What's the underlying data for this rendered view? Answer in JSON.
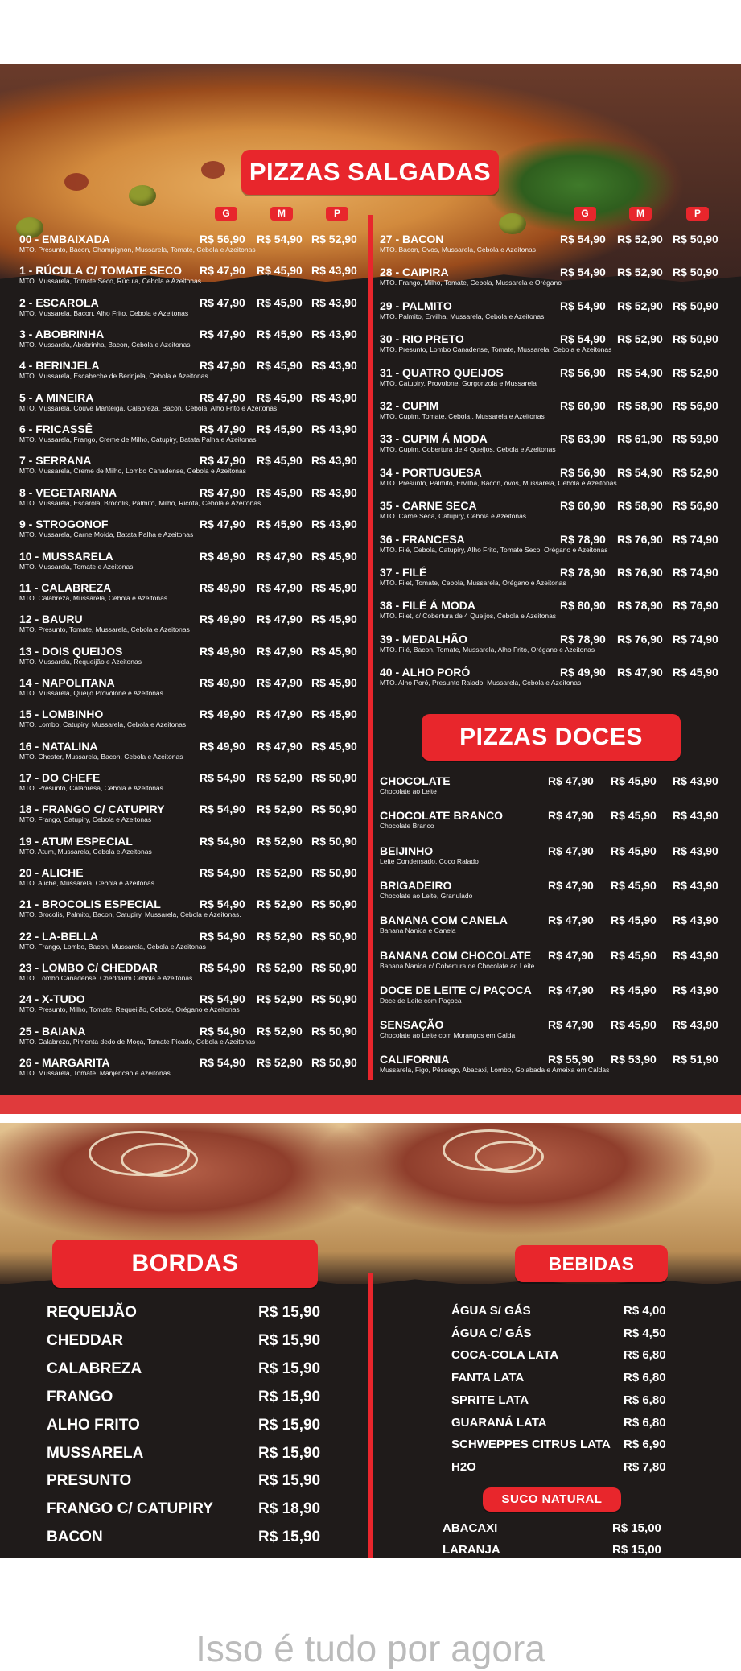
{
  "salgadas": {
    "title": "PIZZAS SALGADAS",
    "size_labels": [
      "G",
      "M",
      "P"
    ],
    "left": [
      {
        "name": "00 - EMBAIXADA",
        "desc": "MTO. Presunto, Bacon, Champignon, Mussarela, Tomate, Cebola e Azeitonas",
        "prices": [
          "R$ 56,90",
          "R$ 54,90",
          "R$ 52,90"
        ]
      },
      {
        "name": "1 - RÚCULA C/ TOMATE SECO",
        "desc": "MTO. Mussarela, Tomate Seco, Rúcula, Cebola e Azeitonas",
        "prices": [
          "R$ 47,90",
          "R$ 45,90",
          "R$ 43,90"
        ]
      },
      {
        "name": "2 - ESCAROLA",
        "desc": "MTO. Mussarela, Bacon, Alho Frito, Cebola e Azeitonas",
        "prices": [
          "R$ 47,90",
          "R$ 45,90",
          "R$ 43,90"
        ]
      },
      {
        "name": "3 - ABOBRINHA",
        "desc": "MTO. Mussarela, Abobrinha, Bacon, Cebola e Azeitonas",
        "prices": [
          "R$ 47,90",
          "R$ 45,90",
          "R$ 43,90"
        ]
      },
      {
        "name": "4 - BERINJELA",
        "desc": "MTO. Mussarela, Escabeche de Berinjela, Cebola e Azeitonas",
        "prices": [
          "R$ 47,90",
          "R$ 45,90",
          "R$ 43,90"
        ]
      },
      {
        "name": "5 - A MINEIRA",
        "desc": "MTO. Mussarela, Couve Manteiga, Calabreza, Bacon, Cebola, Alho Frito e Azeitonas",
        "prices": [
          "R$ 47,90",
          "R$ 45,90",
          "R$ 43,90"
        ]
      },
      {
        "name": "6 - FRICASSÊ",
        "desc": "MTO. Mussarela, Frango, Creme de Milho, Catupiry, Batata Palha e Azeitonas",
        "prices": [
          "R$ 47,90",
          "R$ 45,90",
          "R$ 43,90"
        ]
      },
      {
        "name": "7 - SERRANA",
        "desc": "MTO. Mussarela, Creme de Milho, Lombo Canadense, Cebola e Azeitonas",
        "prices": [
          "R$ 47,90",
          "R$ 45,90",
          "R$ 43,90"
        ]
      },
      {
        "name": "8 - VEGETARIANA",
        "desc": "MTO. Mussarela, Escarola, Brócolis, Palmito, Milho, Ricota, Cebola e Azeitonas",
        "prices": [
          "R$ 47,90",
          "R$ 45,90",
          "R$ 43,90"
        ]
      },
      {
        "name": "9 - STROGONOF",
        "desc": "MTO. Mussarela, Carne Moída, Batata Palha e Azeitonas",
        "prices": [
          "R$ 47,90",
          "R$ 45,90",
          "R$ 43,90"
        ]
      },
      {
        "name": "10 - MUSSARELA",
        "desc": "MTO. Mussarela, Tomate e Azeitonas",
        "prices": [
          "R$ 49,90",
          "R$ 47,90",
          "R$ 45,90"
        ]
      },
      {
        "name": "11 - CALABREZA",
        "desc": "MTO. Calabreza, Mussarela, Cebola e Azeitonas",
        "prices": [
          "R$ 49,90",
          "R$ 47,90",
          "R$ 45,90"
        ]
      },
      {
        "name": "12 - BAURU",
        "desc": "MTO. Presunto, Tomate, Mussarela, Cebola e Azeitonas",
        "prices": [
          "R$ 49,90",
          "R$ 47,90",
          "R$ 45,90"
        ]
      },
      {
        "name": "13 - DOIS QUEIJOS",
        "desc": "MTO. Mussarela, Requeijão e Azeitonas",
        "prices": [
          "R$ 49,90",
          "R$ 47,90",
          "R$ 45,90"
        ]
      },
      {
        "name": "14 - NAPOLITANA",
        "desc": "MTO. Mussarela, Queijo Provolone e Azeitonas",
        "prices": [
          "R$ 49,90",
          "R$ 47,90",
          "R$ 45,90"
        ]
      },
      {
        "name": "15 - LOMBINHO",
        "desc": "MTO. Lombo, Catupiry, Mussarela, Cebola e Azeitonas",
        "prices": [
          "R$ 49,90",
          "R$ 47,90",
          "R$ 45,90"
        ]
      },
      {
        "name": "16 - NATALINA",
        "desc": "MTO. Chester, Mussarela, Bacon, Cebola e Azeitonas",
        "prices": [
          "R$ 49,90",
          "R$ 47,90",
          "R$ 45,90"
        ]
      },
      {
        "name": "17 - DO CHEFE",
        "desc": "MTO. Presunto, Calabresa, Cebola e Azeitonas",
        "prices": [
          "R$ 54,90",
          "R$ 52,90",
          "R$ 50,90"
        ]
      },
      {
        "name": "18 - FRANGO C/ CATUPIRY",
        "desc": "MTO. Frango, Catupiry, Cebola e Azeitonas",
        "prices": [
          "R$ 54,90",
          "R$ 52,90",
          "R$ 50,90"
        ]
      },
      {
        "name": "19 - ATUM ESPECIAL",
        "desc": "MTO. Atum, Mussarela, Cebola e Azeitonas",
        "prices": [
          "R$ 54,90",
          "R$ 52,90",
          "R$ 50,90"
        ]
      },
      {
        "name": "20 - ALICHE",
        "desc": "MTO. Aliche, Mussarela, Cebola e Azeitonas",
        "prices": [
          "R$ 54,90",
          "R$ 52,90",
          "R$ 50,90"
        ]
      },
      {
        "name": "21 - BROCOLIS ESPECIAL",
        "desc": "MTO. Brocolis, Palmito, Bacon, Catupiry, Mussarela, Cebola e Azeitonas.",
        "prices": [
          "R$ 54,90",
          "R$ 52,90",
          "R$ 50,90"
        ]
      },
      {
        "name": "22 - LA-BELLA",
        "desc": "MTO. Frango, Lombo, Bacon, Mussarela, Cebola e Azeitonas",
        "prices": [
          "R$ 54,90",
          "R$ 52,90",
          "R$ 50,90"
        ]
      },
      {
        "name": "23 - LOMBO C/ CHEDDAR",
        "desc": "MTO. Lombo Canadense, Cheddarm Cebola e Azeitonas",
        "prices": [
          "R$ 54,90",
          "R$ 52,90",
          "R$ 50,90"
        ]
      },
      {
        "name": "24 - X-TUDO",
        "desc": "MTO. Presunto, Milho, Tomate, Requeijão, Cebola, Orégano e Azeitonas",
        "prices": [
          "R$ 54,90",
          "R$ 52,90",
          "R$ 50,90"
        ]
      },
      {
        "name": "25 - BAIANA",
        "desc": "MTO. Calabreza, Pimenta dedo de Moça, Tomate Picado, Cebola e Azeitonas",
        "prices": [
          "R$ 54,90",
          "R$ 52,90",
          "R$ 50,90"
        ]
      },
      {
        "name": "26 - MARGARITA",
        "desc": "MTO. Mussarela, Tomate, Manjericão e Azeitonas",
        "prices": [
          "R$ 54,90",
          "R$ 52,90",
          "R$ 50,90"
        ]
      }
    ],
    "right": [
      {
        "name": "27 - BACON",
        "desc": "MTO. Bacon, Ovos, Mussarela, Cebola e Azeitonas",
        "prices": [
          "R$ 54,90",
          "R$ 52,90",
          "R$ 50,90"
        ]
      },
      {
        "name": "28 - CAIPIRA",
        "desc": "MTO. Frango, Milho, Tomate, Cebola, Mussarela e Orégano",
        "prices": [
          "R$ 54,90",
          "R$ 52,90",
          "R$ 50,90"
        ]
      },
      {
        "name": "29 - PALMITO",
        "desc": "MTO. Palmito, Ervilha, Mussarela, Cebola e Azeitonas",
        "prices": [
          "R$ 54,90",
          "R$ 52,90",
          "R$ 50,90"
        ]
      },
      {
        "name": "30 - RIO PRETO",
        "desc": "MTO. Presunto, Lombo Canadense, Tomate, Mussarela, Cebola e Azeitonas",
        "prices": [
          "R$ 54,90",
          "R$ 52,90",
          "R$ 50,90"
        ]
      },
      {
        "name": "31 - QUATRO QUEIJOS",
        "desc": "MTO. Catupiry, Provolone, Gorgonzola e Mussarela",
        "prices": [
          "R$ 56,90",
          "R$ 54,90",
          "R$ 52,90"
        ]
      },
      {
        "name": "32 - CUPIM",
        "desc": "MTO. Cupim, Tomate, Cebola,, Mussarela e Azeitonas",
        "prices": [
          "R$ 60,90",
          "R$ 58,90",
          "R$ 56,90"
        ]
      },
      {
        "name": "33 - CUPIM Á MODA",
        "desc": "MTO. Cupim, Cobertura de 4 Queijos, Cebola e Azeitonas",
        "prices": [
          "R$ 63,90",
          "R$ 61,90",
          "R$ 59,90"
        ]
      },
      {
        "name": "34 - PORTUGUESA",
        "desc": "MTO. Presunto, Palmito, Ervilha, Bacon, ovos, Mussarela, Cebola e Azeitonas",
        "prices": [
          "R$ 56,90",
          "R$ 54,90",
          "R$ 52,90"
        ]
      },
      {
        "name": "35 - CARNE SECA",
        "desc": "MTO. Carne Seca, Catupiry, Cebola e Azeitonas",
        "prices": [
          "R$ 60,90",
          "R$ 58,90",
          "R$ 56,90"
        ]
      },
      {
        "name": "36 - FRANCESA",
        "desc": "MTO. Filé, Cebola, Catupiry, Alho Frito, Tomate Seco, Orégano e Azeitonas",
        "prices": [
          "R$ 78,90",
          "R$ 76,90",
          "R$ 74,90"
        ]
      },
      {
        "name": "37 - FILÉ",
        "desc": "MTO. Filet, Tomate, Cebola, Mussarela, Orégano e Azeitonas",
        "prices": [
          "R$ 78,90",
          "R$ 76,90",
          "R$ 74,90"
        ]
      },
      {
        "name": "38 - FILÉ Á MODA",
        "desc": "MTO. Filet, c/ Cobertura de 4 Queijos, Cebola e Azeitonas",
        "prices": [
          "R$ 80,90",
          "R$ 78,90",
          "R$ 76,90"
        ]
      },
      {
        "name": "39 - MEDALHÃO",
        "desc": "MTO. Filé, Bacon, Tomate, Mussarela, Alho Frito, Orégano e Azeitonas",
        "prices": [
          "R$ 78,90",
          "R$ 76,90",
          "R$ 74,90"
        ]
      },
      {
        "name": "40 - ALHO PORÓ",
        "desc": "MTO. Alho Poró, Presunto Ralado, Mussarela, Cebola e Azeitonas",
        "prices": [
          "R$ 49,90",
          "R$ 47,90",
          "R$ 45,90"
        ]
      }
    ]
  },
  "doces": {
    "title": "PIZZAS DOCES",
    "items": [
      {
        "name": "CHOCOLATE",
        "desc": "Chocolate ao Leite",
        "prices": [
          "R$ 47,90",
          "R$ 45,90",
          "R$ 43,90"
        ]
      },
      {
        "name": "CHOCOLATE BRANCO",
        "desc": "Chocolate Branco",
        "prices": [
          "R$ 47,90",
          "R$ 45,90",
          "R$ 43,90"
        ]
      },
      {
        "name": "BEIJINHO",
        "desc": "Leite Condensado, Coco Ralado",
        "prices": [
          "R$ 47,90",
          "R$ 45,90",
          "R$ 43,90"
        ]
      },
      {
        "name": "BRIGADEIRO",
        "desc": "Chocolate ao Leite, Granulado",
        "prices": [
          "R$ 47,90",
          "R$ 45,90",
          "R$ 43,90"
        ]
      },
      {
        "name": "BANANA COM CANELA",
        "desc": "Banana Nanica e Canela",
        "prices": [
          "R$ 47,90",
          "R$ 45,90",
          "R$ 43,90"
        ]
      },
      {
        "name": "BANANA COM CHOCOLATE",
        "desc": "Banana Nanica c/ Cobertura de Chocolate ao Leite",
        "prices": [
          "R$ 47,90",
          "R$ 45,90",
          "R$ 43,90"
        ]
      },
      {
        "name": "DOCE DE LEITE C/ PAÇOCA",
        "desc": "Doce de Leite com Paçoca",
        "prices": [
          "R$ 47,90",
          "R$ 45,90",
          "R$ 43,90"
        ]
      },
      {
        "name": "SENSAÇÃO",
        "desc": "Chocolate ao Leite com Morangos em Calda",
        "prices": [
          "R$ 47,90",
          "R$ 45,90",
          "R$ 43,90"
        ]
      },
      {
        "name": "CALIFORNIA",
        "desc": "Mussarela, Figo, Pêssego, Abacaxi, Lombo, Goiabada e Ameixa em Caldas",
        "prices": [
          "R$ 55,90",
          "R$ 53,90",
          "R$ 51,90"
        ]
      }
    ]
  },
  "bordas": {
    "title": "BORDAS",
    "items": [
      {
        "name": "REQUEIJÃO",
        "price": "R$ 15,90"
      },
      {
        "name": "CHEDDAR",
        "price": "R$ 15,90"
      },
      {
        "name": "CALABREZA",
        "price": "R$ 15,90"
      },
      {
        "name": "FRANGO",
        "price": "R$ 15,90"
      },
      {
        "name": "ALHO FRITO",
        "price": "R$ 15,90"
      },
      {
        "name": "MUSSARELA",
        "price": "R$ 15,90"
      },
      {
        "name": "PRESUNTO",
        "price": "R$ 15,90"
      },
      {
        "name": "FRANGO C/ CATUPIRY",
        "price": "R$ 18,90"
      },
      {
        "name": "BACON",
        "price": "R$ 15,90"
      }
    ]
  },
  "bebidas": {
    "title": "BEBIDAS",
    "items": [
      {
        "name": "ÁGUA S/ GÁS",
        "price": "R$ 4,00"
      },
      {
        "name": "ÁGUA C/ GÁS",
        "price": "R$ 4,50"
      },
      {
        "name": "COCA-COLA LATA",
        "price": "R$ 6,80"
      },
      {
        "name": "FANTA LATA",
        "price": "R$ 6,80"
      },
      {
        "name": "SPRITE LATA",
        "price": "R$ 6,80"
      },
      {
        "name": "GUARANÁ LATA",
        "price": "R$ 6,80"
      },
      {
        "name": "SCHWEPPES CITRUS LATA",
        "price": "R$ 6,90"
      },
      {
        "name": "H2O",
        "price": "R$ 7,80"
      }
    ],
    "suco_title": "SUCO NATURAL",
    "sucos": [
      {
        "name": "ABACAXI",
        "price": "R$ 15,00"
      },
      {
        "name": "LARANJA",
        "price": "R$ 15,00"
      }
    ]
  },
  "footer": {
    "text": "Isso é tudo por agora"
  },
  "colors": {
    "accent": "#e8262c",
    "background": "#1f1b1a",
    "text": "#ffffff"
  }
}
